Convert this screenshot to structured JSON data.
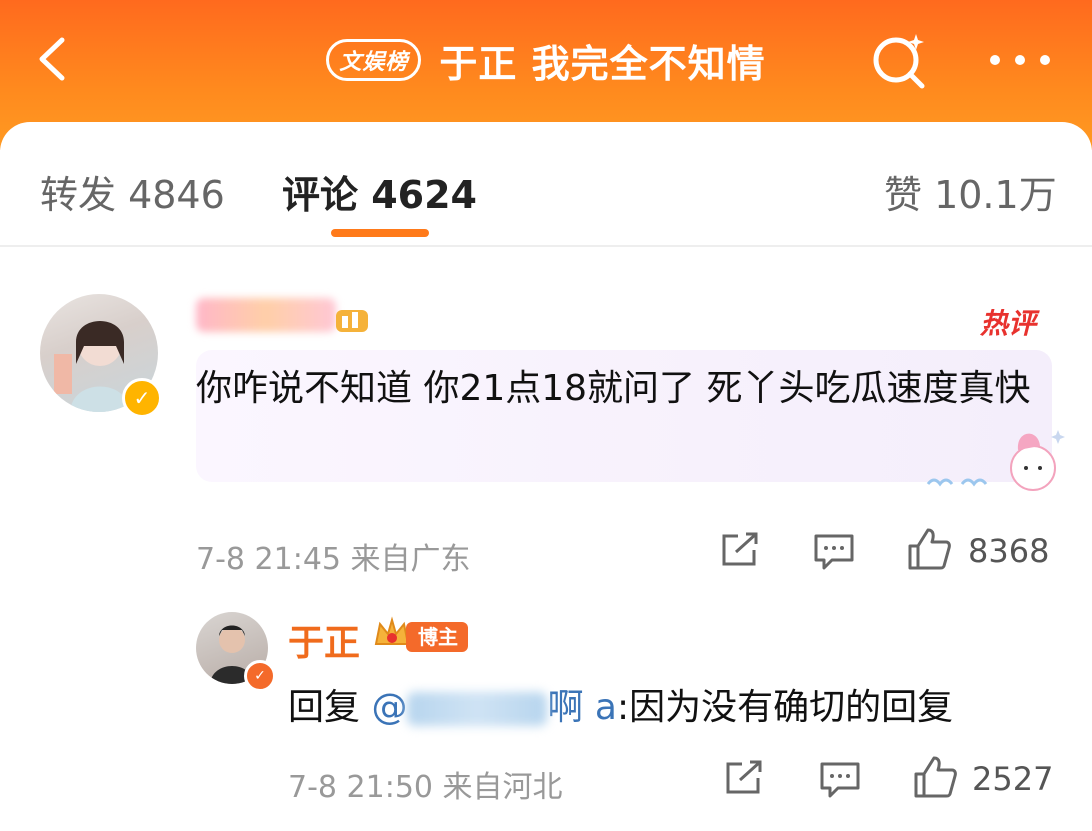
{
  "header": {
    "badge": "文娱榜",
    "title": "于正 我完全不知情"
  },
  "tabs": {
    "repost": "转发 4846",
    "comment": "评论 4624",
    "like": "赞 10.1万"
  },
  "comment": {
    "hot_tag": "热评",
    "text": "你咋说不知道 你21点18就问了 死丫头吃瓜速度真快",
    "meta": "7-8 21:45 来自广东",
    "likes": "8368"
  },
  "reply": {
    "author": "于正",
    "author_tag": "博主",
    "prefix": "回复 ",
    "mention_prefix": "@",
    "mention_suffix": "啊 a",
    "text": ":因为没有确切的回复",
    "meta": "7-8 21:50 来自河北",
    "likes": "2527"
  },
  "colors": {
    "header_bg": "#ff7a1e",
    "accent": "#ff7a1a",
    "hot_tag": "#e8322e",
    "mention": "#3b74b7"
  },
  "icons": [
    "back-icon",
    "search-icon",
    "more-icon",
    "share-icon",
    "comment-icon",
    "like-icon",
    "verified-icon",
    "crown-icon"
  ]
}
